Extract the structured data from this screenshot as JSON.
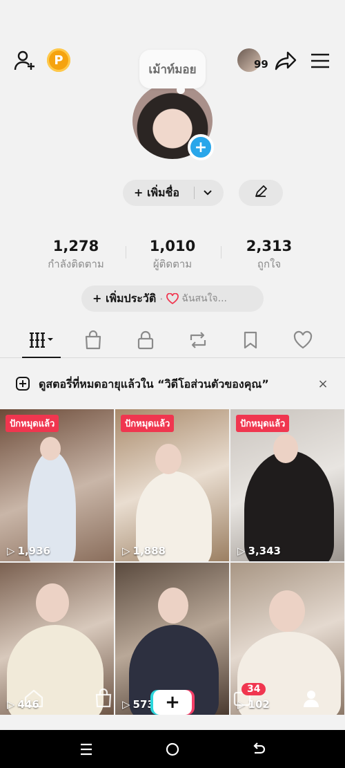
{
  "header": {
    "coin_letter": "P",
    "mini_count": "99"
  },
  "profile": {
    "note_bubble": "เม้าท์มอย",
    "add_name_label": "+ เพิ่มชื่อ"
  },
  "stats": [
    {
      "value": "1,278",
      "label": "กำลังติดตาม"
    },
    {
      "value": "1,010",
      "label": "ผู้ติดตาม"
    },
    {
      "value": "2,313",
      "label": "ถูกใจ"
    }
  ],
  "bio": {
    "add_label": "+ เพิ่มประวัติ",
    "separator": "·",
    "interest": "ฉันสนใจ..."
  },
  "tabs": [
    {
      "icon": "grid-icon"
    },
    {
      "icon": "shopping-bag-icon"
    },
    {
      "icon": "lock-icon"
    },
    {
      "icon": "repost-icon"
    },
    {
      "icon": "bookmark-icon"
    },
    {
      "icon": "heart-icon"
    }
  ],
  "notice": {
    "text": "ดูสตอรี่ที่หมดอายุแล้วใน “วิดีโอส่วนตัวของคุณ”",
    "close": "×"
  },
  "videos": [
    {
      "badge": "ปักหมุดแล้ว",
      "views": "1,936"
    },
    {
      "badge": "ปักหมุดแล้ว",
      "views": "1,888"
    },
    {
      "badge": "ปักหมุดแล้ว",
      "views": "3,343"
    },
    {
      "badge": "",
      "views": "446"
    },
    {
      "badge": "",
      "views": "573"
    },
    {
      "badge": "",
      "views": "102"
    }
  ],
  "bottom_nav": {
    "create": "+",
    "inbox_badge": "34"
  },
  "colors": {
    "accent_red": "#f0364f",
    "avatar_plus_blue": "#29a6ea",
    "coin_orange": "#f5a30f"
  }
}
